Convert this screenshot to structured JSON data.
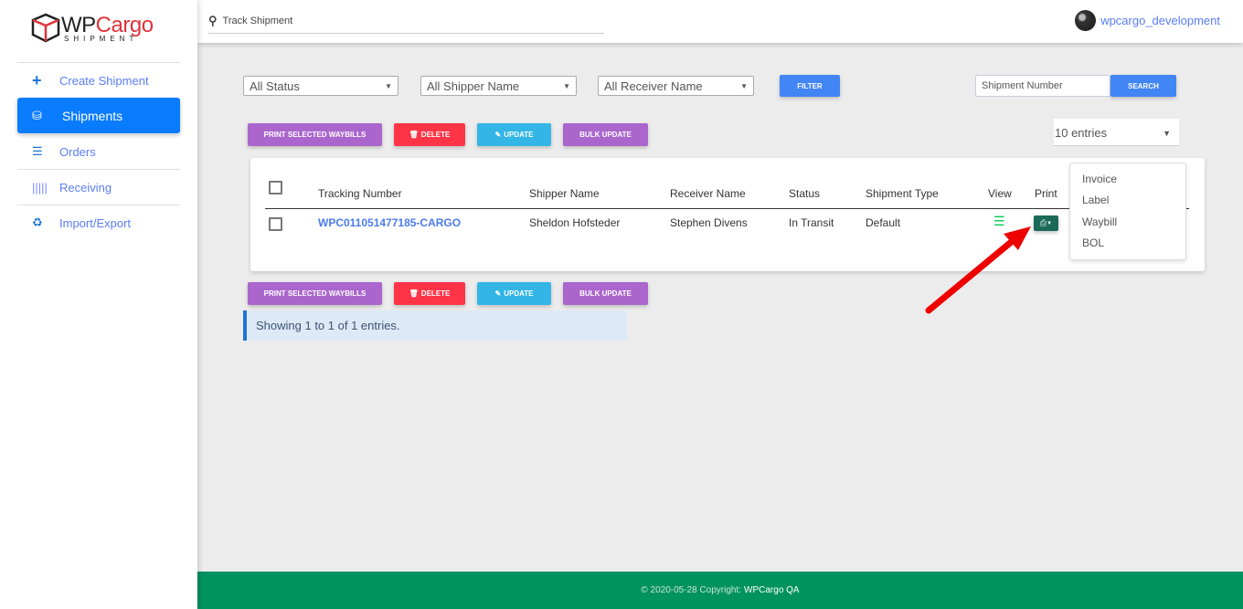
{
  "logo": {
    "name_dark": "WP",
    "name_accent": "Cargo",
    "tagline": "SHIPMENT"
  },
  "sidebar": {
    "items": [
      {
        "label": "Create Shipment",
        "icon": "plus-icon"
      },
      {
        "label": "Shipments",
        "icon": "cubes-icon",
        "active": true
      },
      {
        "label": "Orders",
        "icon": "list-icon"
      },
      {
        "label": "Receiving",
        "icon": "barcode-icon"
      },
      {
        "label": "Import/Export",
        "icon": "recycle-icon"
      }
    ]
  },
  "header": {
    "search_placeholder": "Track Shipment",
    "username": "wpcargo_development"
  },
  "filters": {
    "status": "All Status",
    "shipper": "All Shipper Name",
    "receiver": "All Receiver Name",
    "filter_label": "FILTER",
    "shipment_number_placeholder": "Shipment Number",
    "search_label": "SEARCH",
    "entries": "10 entries"
  },
  "actions": {
    "print": "PRINT SELECTED WAYBILLS",
    "delete": "DELETE",
    "update": "UPDATE",
    "bulk": "BULK UPDATE"
  },
  "colors": {
    "primary": "#0a7cff",
    "purple": "#aa66cc",
    "red": "#ff3547",
    "cyan": "#33b5e5",
    "blue": "#4285f4",
    "footer": "#00925f",
    "print_button": "#1b6a57"
  },
  "table": {
    "columns": [
      "Tracking Number",
      "Shipper Name",
      "Receiver Name",
      "Status",
      "Shipment Type",
      "View",
      "Print"
    ],
    "rows": [
      {
        "tracking": "WPC011051477185-CARGO",
        "shipper": "Sheldon Hofsteder",
        "receiver": "Stephen Divens",
        "status": "In Transit",
        "type": "Default"
      }
    ]
  },
  "print_menu": [
    "Invoice",
    "Label",
    "Waybill",
    "BOL"
  ],
  "info": "Showing 1 to 1 of 1 entries.",
  "footer": {
    "text": "© 2020-05-28 Copyright:",
    "brand": "WPCargo QA"
  }
}
